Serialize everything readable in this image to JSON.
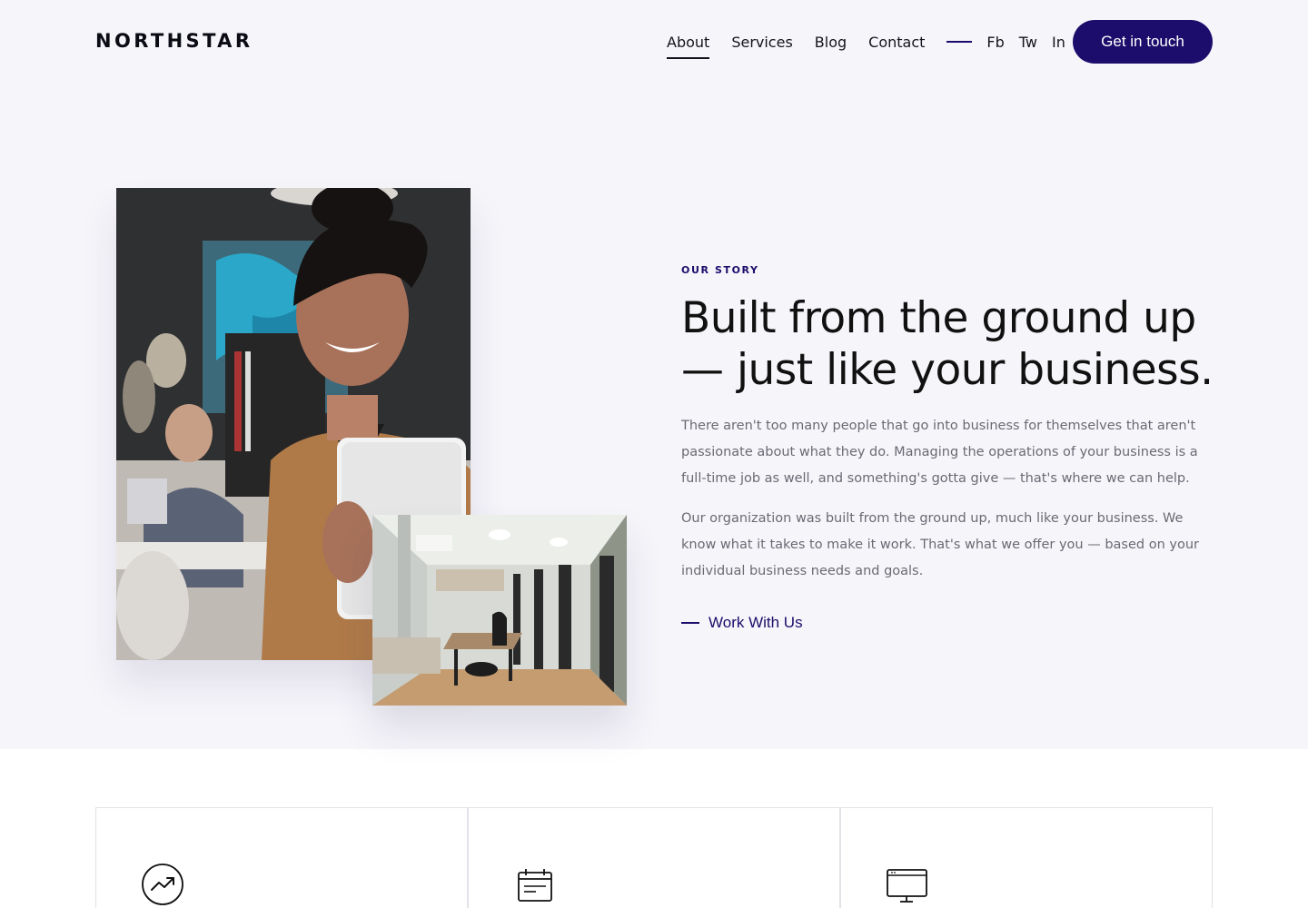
{
  "brand": {
    "logo": "NORTHSTAR",
    "accent_color": "#1c0c6b",
    "hero_bg": "#f6f5fa"
  },
  "nav": {
    "links": [
      {
        "label": "About",
        "active": true
      },
      {
        "label": "Services",
        "active": false
      },
      {
        "label": "Blog",
        "active": false
      },
      {
        "label": "Contact",
        "active": false
      }
    ],
    "social": [
      "Fb",
      "Tw",
      "In"
    ],
    "cta_label": "Get in touch"
  },
  "story": {
    "eyebrow": "OUR STORY",
    "headline": "Built from the ground up — just like your business.",
    "paragraphs": [
      "There aren't too many people that go into business for themselves that aren't passionate about what they do. Managing the operations of your business is a full-time job as well, and something's gotta give — that's where we can help.",
      "Our organization was built from the ground up, much like your business. We know what it takes to make it work. That's what we offer you — based on your individual business needs and goals."
    ],
    "link_label": "Work With Us"
  },
  "images": {
    "main": "photo-woman-holding-laptop",
    "secondary": "photo-office-room"
  },
  "features": [
    {
      "icon": "trending-up-icon"
    },
    {
      "icon": "calendar-icon"
    },
    {
      "icon": "monitor-icon"
    }
  ]
}
